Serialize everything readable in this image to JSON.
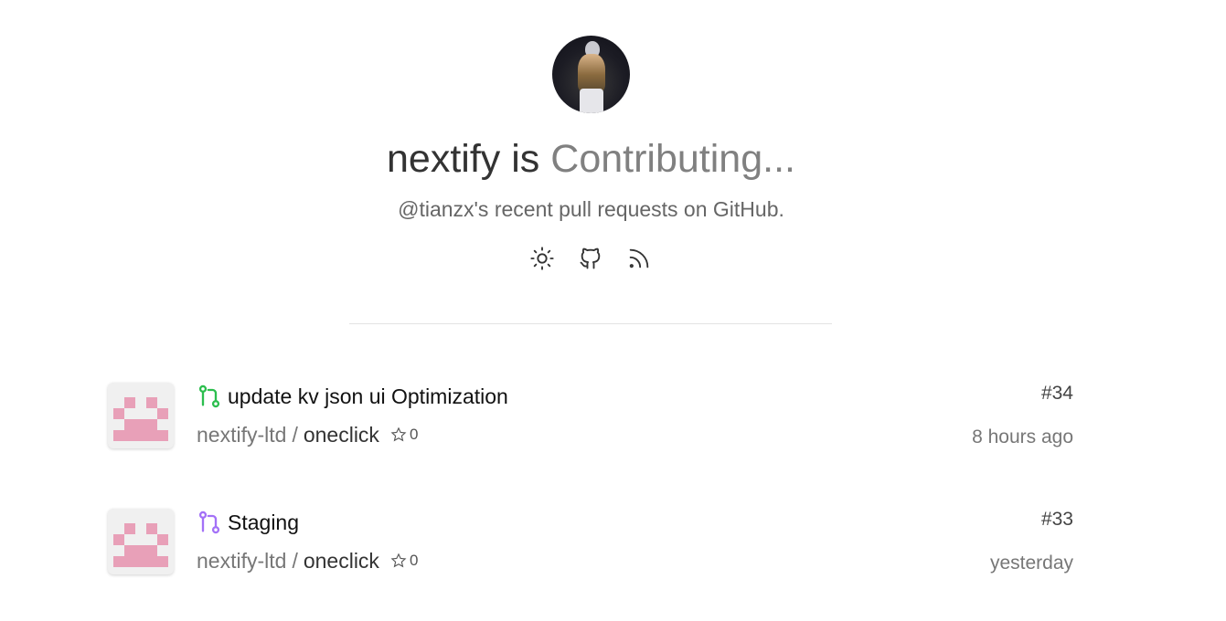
{
  "profile": {
    "name": "nextify",
    "connector": "is",
    "status": "Contributing...",
    "subtitle": "@tianzx's recent pull requests on GitHub.",
    "avatar_icon": "user-avatar"
  },
  "toolbar": {
    "icons": [
      "sun-icon",
      "github-icon",
      "rss-icon"
    ]
  },
  "colors": {
    "open_pr": "#2cbe4e",
    "merged_pr": "#a371f7",
    "identicon": "#e8a0b8"
  },
  "pull_requests": [
    {
      "title": "update kv json ui Optimization",
      "owner": "nextify-ltd",
      "separator": "/",
      "repo": "oneclick",
      "stars": "0",
      "number": "#34",
      "time": "8 hours ago",
      "state": "open"
    },
    {
      "title": "Staging",
      "owner": "nextify-ltd",
      "separator": "/",
      "repo": "oneclick",
      "stars": "0",
      "number": "#33",
      "time": "yesterday",
      "state": "merged"
    }
  ]
}
